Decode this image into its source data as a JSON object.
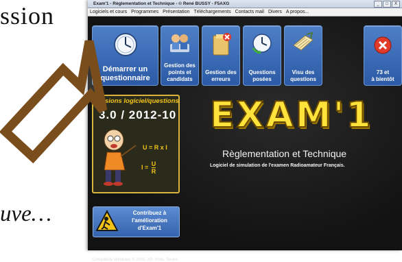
{
  "slide": {
    "top_text": "ssion",
    "bottom_text": "uve…"
  },
  "window": {
    "title": "Exam'1 - Règlementation et Technique - © René BUSSY - F5AXG",
    "controls": [
      "_",
      "□",
      "X"
    ]
  },
  "menu": [
    "Logiciels et cours",
    "Programmes",
    "Présentation",
    "Téléchargements",
    "Contacts mail",
    "Divers",
    "A propos..."
  ],
  "tiles": {
    "start": {
      "label_line1": "Démarrer un",
      "label_line2": "questionnaire",
      "icon": "clock-icon"
    },
    "manage": {
      "label_line1": "Gestion des",
      "label_line2": "points et",
      "label_line3": "candidats",
      "icon": "people-icon"
    },
    "errors": {
      "label_line1": "Gestion des",
      "label_line2": "erreurs",
      "icon": "folder-error-icon"
    },
    "questions": {
      "label_line1": "Questions",
      "label_line2": "posées",
      "icon": "clock-refresh-icon"
    },
    "view": {
      "label_line1": "Visu des",
      "label_line2": "questions",
      "icon": "notes-icon"
    },
    "exit": {
      "label_line1": "73 et",
      "label_line2": "à bientôt",
      "icon": "close-icon"
    }
  },
  "version": {
    "title": "Versions logiciel/questions",
    "value": "3.0  /  2012-10",
    "formula1": "U = R x I",
    "formula2_left": "I =",
    "formula2_num": "U",
    "formula2_den": "R"
  },
  "app": {
    "logo": "EXAM'1",
    "subtitle": "Règlementation et Technique",
    "tagline": "Logiciel de simulation de l'examen Radioamateur Français."
  },
  "contribute": {
    "line1": "Contribuez à",
    "line2": "l'amélioration",
    "line3": "d'Exam'1"
  },
  "compat": "Compatible Windows ® 2000, XP, Vista, Seven",
  "colors": {
    "tile_blue": "#3a6cb8",
    "logo_yellow": "#ffe23a",
    "arrow_brown": "#7a4e1c",
    "exit_red": "#e03a2a"
  }
}
